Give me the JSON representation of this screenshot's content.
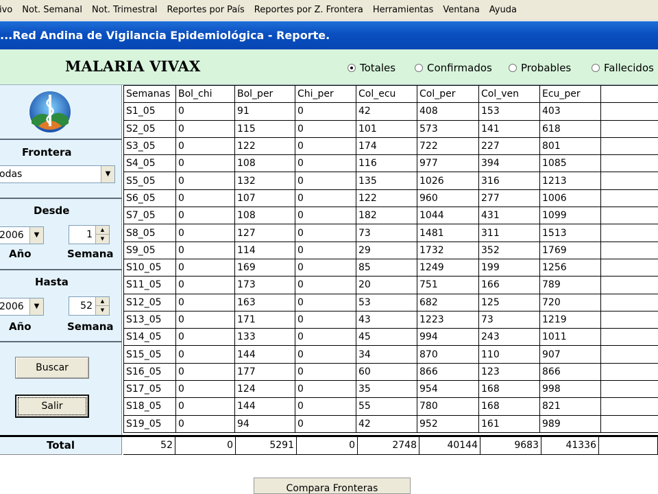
{
  "menu": [
    "ivo",
    "Not. Semanal",
    "Not. Trimestral",
    "Reportes por País",
    "Reportes por Z. Frontera",
    "Herramientas",
    "Ventana",
    "Ayuda"
  ],
  "window_title": "...Red Andina de Vigilancia Epidemiológica - Reporte.",
  "report_title": "MALARIA VIVAX",
  "radio_options": [
    {
      "label": "Totales",
      "selected": true
    },
    {
      "label": "Confirmados",
      "selected": false
    },
    {
      "label": "Probables",
      "selected": false
    },
    {
      "label": "Fallecidos",
      "selected": false
    }
  ],
  "left": {
    "frontera_label": "Frontera",
    "frontera_value": "odas",
    "desde_label": "Desde",
    "desde_year": "2006",
    "desde_week": "1",
    "hasta_label": "Hasta",
    "hasta_year": "2006",
    "hasta_week": "52",
    "anio_label": "Año",
    "semana_label": "Semana",
    "buscar": "Buscar",
    "salir": "Salir"
  },
  "table": {
    "columns": [
      "Semanas",
      "Bol_chi",
      "Bol_per",
      "Chi_per",
      "Col_ecu",
      "Col_per",
      "Col_ven",
      "Ecu_per"
    ],
    "rows": [
      [
        "S1_05",
        "0",
        "91",
        "0",
        "42",
        "408",
        "153",
        "403"
      ],
      [
        "S2_05",
        "0",
        "115",
        "0",
        "101",
        "573",
        "141",
        "618"
      ],
      [
        "S3_05",
        "0",
        "122",
        "0",
        "174",
        "722",
        "227",
        "801"
      ],
      [
        "S4_05",
        "0",
        "108",
        "0",
        "116",
        "977",
        "394",
        "1085"
      ],
      [
        "S5_05",
        "0",
        "132",
        "0",
        "135",
        "1026",
        "316",
        "1213"
      ],
      [
        "S6_05",
        "0",
        "107",
        "0",
        "122",
        "960",
        "277",
        "1006"
      ],
      [
        "S7_05",
        "0",
        "108",
        "0",
        "182",
        "1044",
        "431",
        "1099"
      ],
      [
        "S8_05",
        "0",
        "127",
        "0",
        "73",
        "1481",
        "311",
        "1513"
      ],
      [
        "S9_05",
        "0",
        "114",
        "0",
        "29",
        "1732",
        "352",
        "1769"
      ],
      [
        "S10_05",
        "0",
        "169",
        "0",
        "85",
        "1249",
        "199",
        "1256"
      ],
      [
        "S11_05",
        "0",
        "173",
        "0",
        "20",
        "751",
        "166",
        "789"
      ],
      [
        "S12_05",
        "0",
        "163",
        "0",
        "53",
        "682",
        "125",
        "720"
      ],
      [
        "S13_05",
        "0",
        "171",
        "0",
        "43",
        "1223",
        "73",
        "1219"
      ],
      [
        "S14_05",
        "0",
        "133",
        "0",
        "45",
        "994",
        "243",
        "1011"
      ],
      [
        "S15_05",
        "0",
        "144",
        "0",
        "34",
        "870",
        "110",
        "907"
      ],
      [
        "S16_05",
        "0",
        "177",
        "0",
        "60",
        "866",
        "123",
        "866"
      ],
      [
        "S17_05",
        "0",
        "124",
        "0",
        "35",
        "954",
        "168",
        "998"
      ],
      [
        "S18_05",
        "0",
        "144",
        "0",
        "55",
        "780",
        "168",
        "821"
      ],
      [
        "S19_05",
        "0",
        "94",
        "0",
        "42",
        "952",
        "161",
        "989"
      ]
    ],
    "total_label": "Total",
    "totals": [
      "52",
      "0",
      "5291",
      "0",
      "2748",
      "40144",
      "9683",
      "41336"
    ]
  },
  "compare_button": "Compara Fronteras"
}
